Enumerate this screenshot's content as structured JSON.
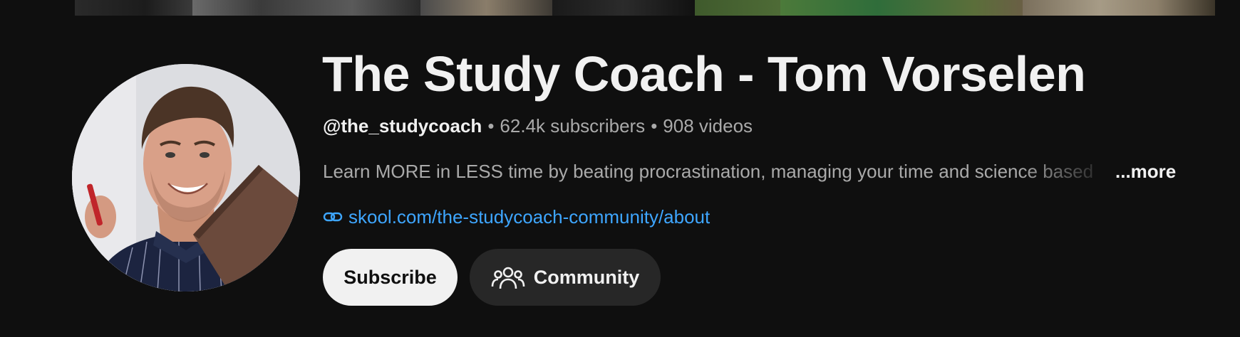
{
  "channel": {
    "title": "The Study Coach - Tom Vorselen",
    "handle": "@the_studycoach",
    "subscribers": "62.4k subscribers",
    "videos": "908 videos",
    "separator": "•",
    "description": "Learn MORE in LESS time by beating procrastination, managing your time and science based",
    "more_label": "...more",
    "link_text": "skool.com/the-studycoach-community/about"
  },
  "actions": {
    "subscribe_label": "Subscribe",
    "community_label": "Community"
  },
  "icons": {
    "link": "link-icon",
    "community": "community-icon"
  },
  "colors": {
    "background": "#0f0f0f",
    "link": "#3ea6ff",
    "subscribe_bg": "#f1f1f1",
    "community_bg": "#272727",
    "secondary_text": "#aaaaaa"
  }
}
